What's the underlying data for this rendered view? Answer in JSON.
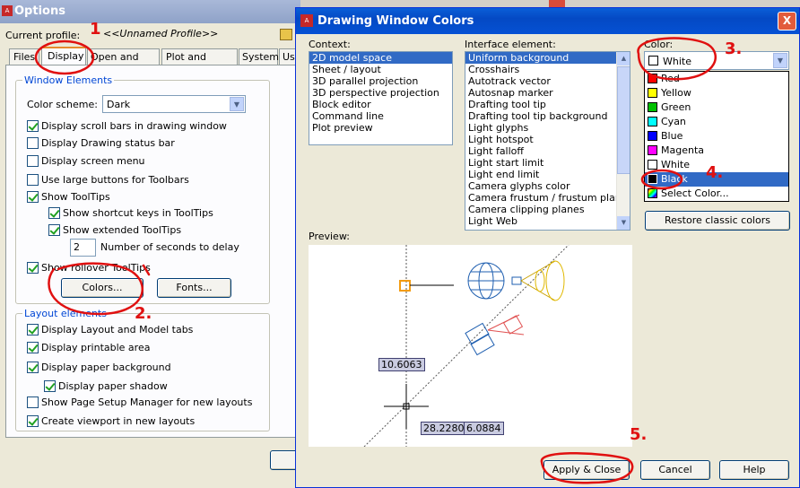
{
  "options_window": {
    "title": "Options",
    "current_profile_label": "Current profile:",
    "current_profile_value": "<<Unnamed Profile>>",
    "tabs": [
      "Files",
      "Display",
      "Open and Save",
      "Plot and Publish",
      "System",
      "Us"
    ],
    "window_elements": {
      "title": "Window Elements",
      "color_scheme_label": "Color scheme:",
      "color_scheme_value": "Dark",
      "checks": [
        {
          "label": "Display scroll bars in drawing window",
          "checked": true
        },
        {
          "label": "Display Drawing status bar",
          "checked": false
        },
        {
          "label": "Display screen menu",
          "checked": false
        },
        {
          "label": "Use large buttons for Toolbars",
          "checked": false
        },
        {
          "label": "Show ToolTips",
          "checked": true
        },
        {
          "label": "Show shortcut keys in ToolTips",
          "checked": true
        },
        {
          "label": "Show extended ToolTips",
          "checked": true
        },
        {
          "label": "Show rollover ToolTips",
          "checked": true
        }
      ],
      "delay_value": "2",
      "delay_label": "Number of seconds to delay",
      "colors_button": "Colors...",
      "fonts_button": "Fonts..."
    },
    "layout_elements": {
      "title": "Layout elements",
      "checks": [
        {
          "label": "Display Layout and Model tabs",
          "checked": true
        },
        {
          "label": "Display printable area",
          "checked": true
        },
        {
          "label": "Display paper background",
          "checked": true
        },
        {
          "label": "Display paper shadow",
          "checked": true
        },
        {
          "label": "Show Page Setup Manager for new layouts",
          "checked": false
        },
        {
          "label": "Create viewport in new layouts",
          "checked": true
        }
      ]
    }
  },
  "dialog": {
    "title": "Drawing Window Colors",
    "close_label": "X",
    "context_label": "Context:",
    "context_items": [
      "2D model space",
      "Sheet / layout",
      "3D parallel projection",
      "3D perspective projection",
      "Block editor",
      "Command line",
      "Plot preview"
    ],
    "interface_label": "Interface element:",
    "interface_items": [
      "Uniform background",
      "Crosshairs",
      "Autotrack vector",
      "Autosnap marker",
      "Drafting tool tip",
      "Drafting tool tip background",
      "Light glyphs",
      "Light hotspot",
      "Light falloff",
      "Light start limit",
      "Light end limit",
      "Camera glyphs color",
      "Camera frustum / frustum plane",
      "Camera clipping planes",
      "Light Web"
    ],
    "color_label": "Color:",
    "color_value": "White",
    "color_options": [
      {
        "label": "Red",
        "color": "#ff0000"
      },
      {
        "label": "Yellow",
        "color": "#ffff00"
      },
      {
        "label": "Green",
        "color": "#00c000"
      },
      {
        "label": "Cyan",
        "color": "#00ffff"
      },
      {
        "label": "Blue",
        "color": "#0000ff"
      },
      {
        "label": "Magenta",
        "color": "#ff00ff"
      },
      {
        "label": "White",
        "color": "#ffffff"
      },
      {
        "label": "Black",
        "color": "#000000"
      },
      {
        "label": "Select Color...",
        "color": "multi"
      }
    ],
    "restore_button": "Restore classic colors",
    "preview_label": "Preview:",
    "preview_values": [
      "10.6063",
      "28.2280",
      "6.0884"
    ],
    "apply_button": "Apply & Close",
    "cancel_button": "Cancel",
    "help_button": "Help"
  },
  "annotations": [
    "1",
    "2.",
    "3.",
    "4.",
    "5."
  ]
}
